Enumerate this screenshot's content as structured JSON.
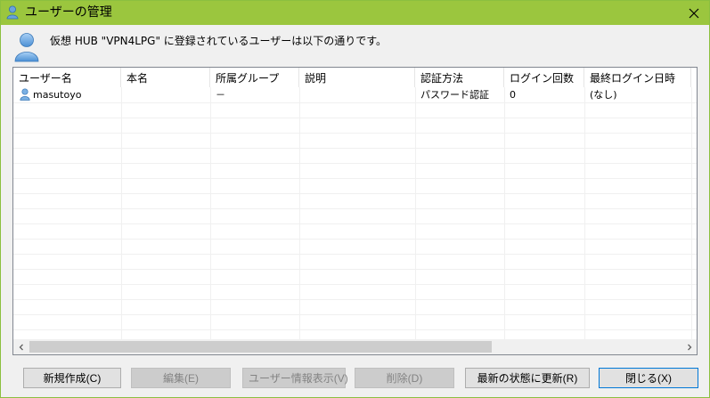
{
  "window": {
    "title": "ユーザーの管理",
    "accent_color": "#9bc63e"
  },
  "header": {
    "message": "仮想 HUB \"VPN4LPG\" に登録されているユーザーは以下の通りです。"
  },
  "table": {
    "columns": [
      "ユーザー名",
      "本名",
      "所属グループ",
      "説明",
      "認証方法",
      "ログイン回数",
      "最終ログイン日時"
    ],
    "rows": [
      {
        "icon": "user-icon",
        "user": "masutoyo",
        "real_name": "",
        "group": "－",
        "description": "",
        "auth": "パスワード認証",
        "logins": "0",
        "last_login": "(なし)"
      }
    ]
  },
  "buttons": {
    "new": "新規作成(C)",
    "edit": "編集(E)",
    "info": "ユーザー情報表示(V)",
    "delete": "削除(D)",
    "refresh": "最新の状態に更新(R)",
    "close": "閉じる(X)"
  },
  "icons": {
    "title": "user-icon",
    "header": "user-icon",
    "close": "close-icon"
  }
}
